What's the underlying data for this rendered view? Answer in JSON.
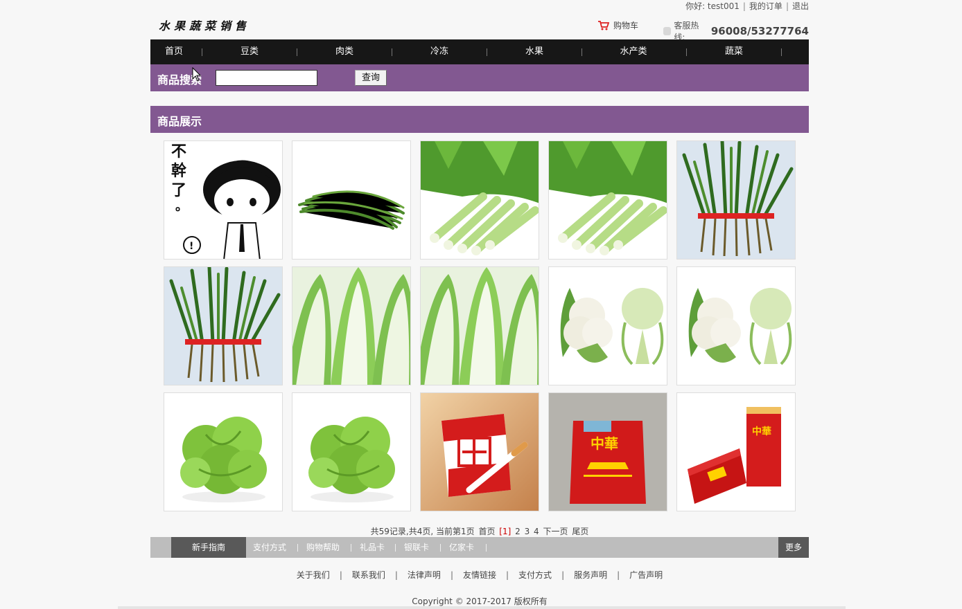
{
  "topbar": {
    "greeting": "你好: test001",
    "my_orders": "我的订单",
    "logout": "退出"
  },
  "header": {
    "logo_text": "水果蔬菜销售",
    "cart_label": "购物车",
    "hotline_label": "客服热线:",
    "hotline_number": "96008/53277764"
  },
  "nav": {
    "items": [
      "首页",
      "豆类",
      "肉类",
      "冷冻",
      "水果",
      "水产类",
      "蔬菜"
    ]
  },
  "search": {
    "title": "商品搜索",
    "input_value": "",
    "button_label": "查询"
  },
  "section": {
    "title": "商品展示"
  },
  "products": [
    {
      "icon": "cartoon-boy-image"
    },
    {
      "icon": "green-beans-image"
    },
    {
      "icon": "celery-image"
    },
    {
      "icon": "celery-image"
    },
    {
      "icon": "chives-bundle-image"
    },
    {
      "icon": "chives-bundle-image"
    },
    {
      "icon": "napa-cabbage-image"
    },
    {
      "icon": "napa-cabbage-image"
    },
    {
      "icon": "cauliflower-image"
    },
    {
      "icon": "cauliflower-image"
    },
    {
      "icon": "lettuce-image"
    },
    {
      "icon": "lettuce-image"
    },
    {
      "icon": "cigarette-pack-image"
    },
    {
      "icon": "cigarette-pack-image"
    },
    {
      "icon": "cigarette-pack-image"
    }
  ],
  "pager": {
    "summary": "共59记录,共4页, 当前第1页",
    "first": "首页",
    "current": "[1]",
    "p2": "2",
    "p3": "3",
    "p4": "4",
    "next": "下一页",
    "last": "尾页"
  },
  "bottom_tabs": {
    "active": "新手指南",
    "items": [
      "支付方式",
      "购物帮助",
      "礼品卡",
      "银联卡",
      "亿家卡"
    ],
    "more": "更多"
  },
  "footer": {
    "links": [
      "关于我们",
      "联系我们",
      "法律声明",
      "友情链接",
      "支付方式",
      "服务声明",
      "广告声明"
    ],
    "copyright": "Copyright © 2017-2017 版权所有"
  },
  "colors": {
    "accent_purple": "#825891",
    "nav_black": "#171717",
    "tab_gray": "#595959"
  }
}
